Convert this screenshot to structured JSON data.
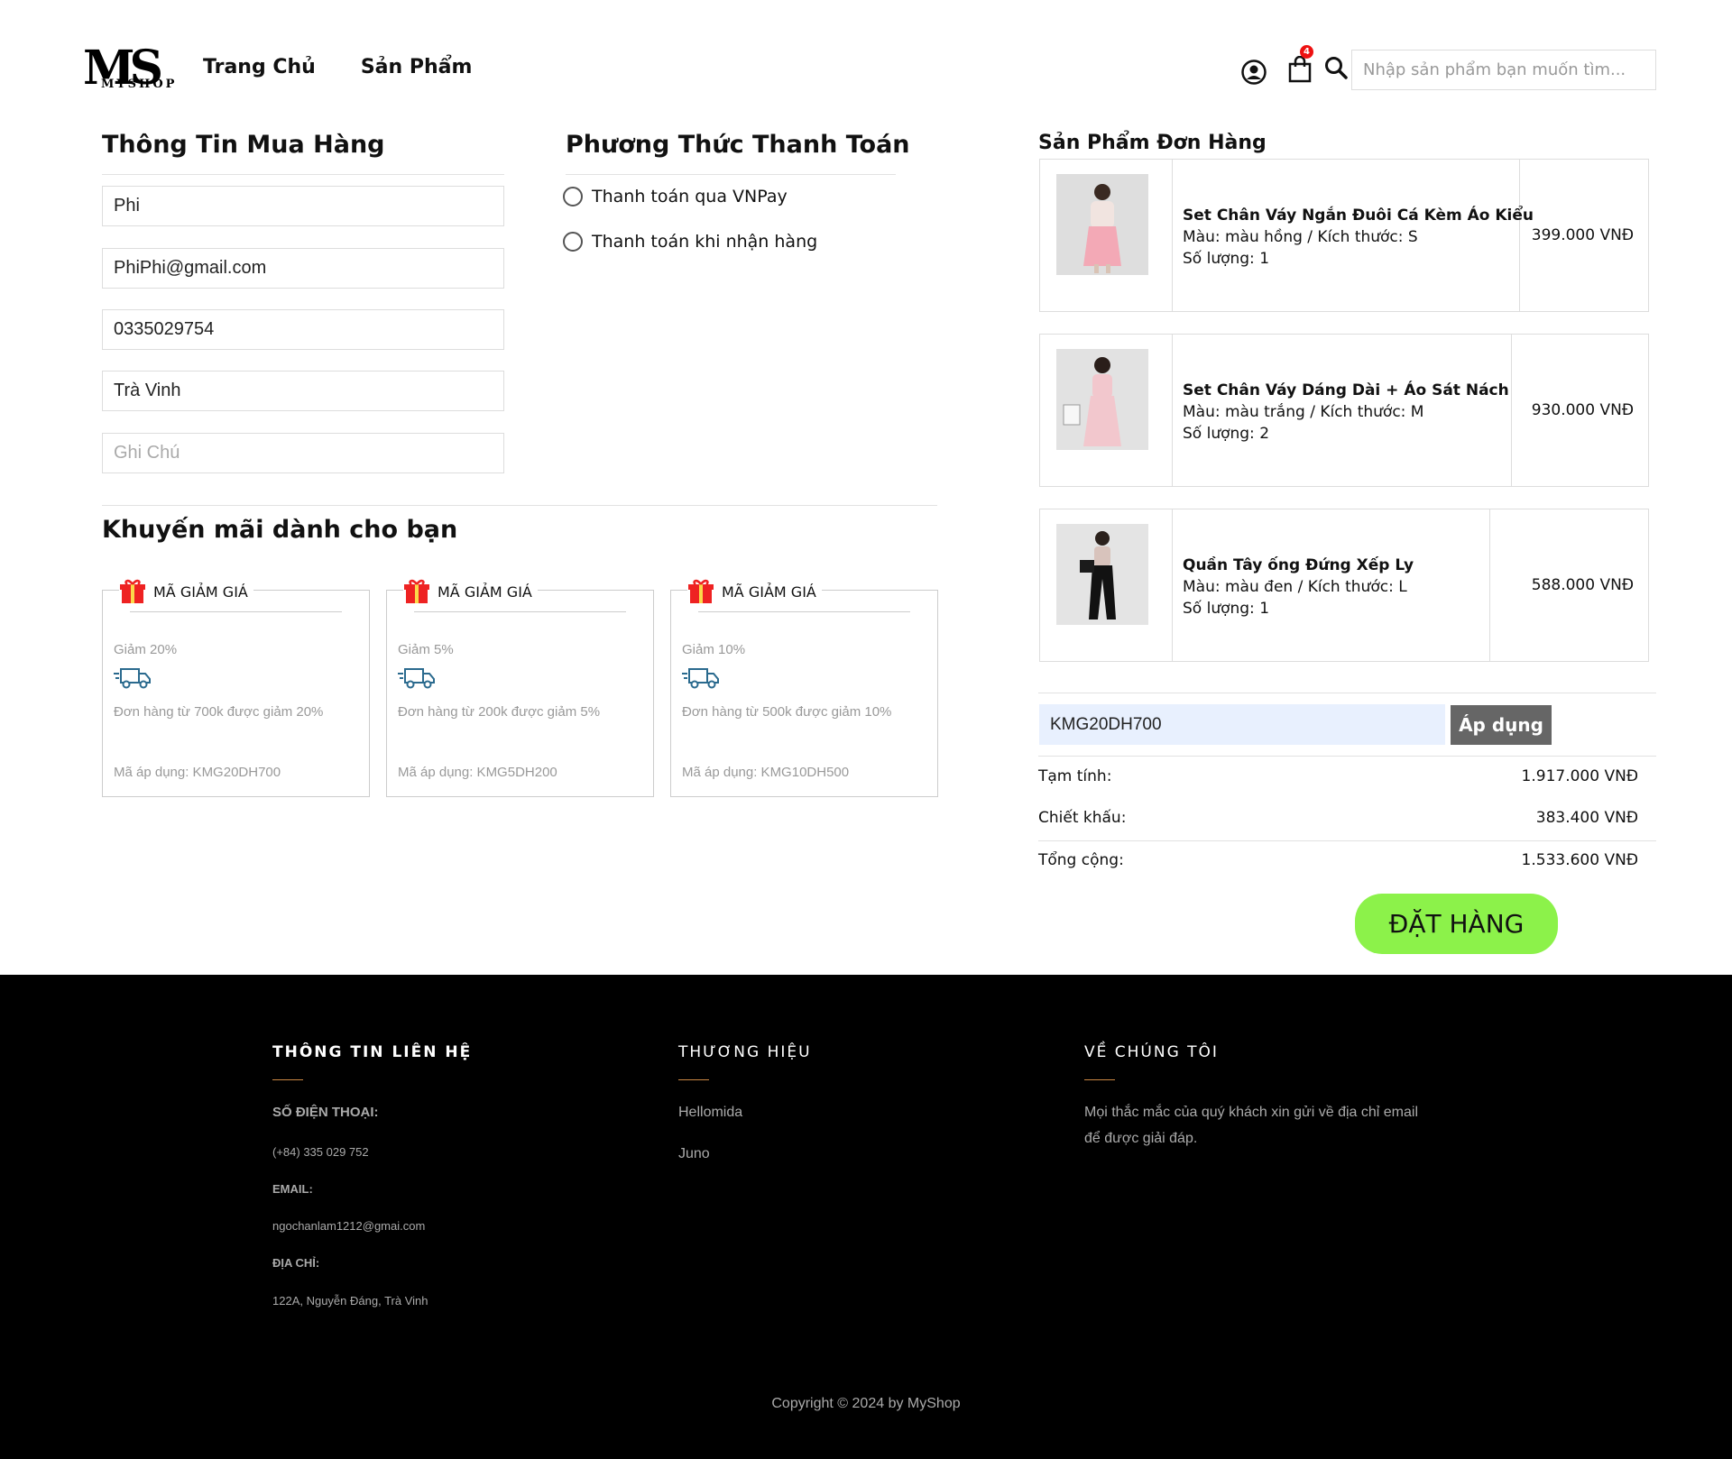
{
  "header": {
    "logo_main": "MS",
    "logo_sub": "MYSHOP",
    "nav": [
      "Trang Chủ",
      "Sản Phẩm"
    ],
    "cart_count": "4",
    "search_placeholder": "Nhập sản phẩm bạn muốn tìm..."
  },
  "buyer": {
    "title": "Thông Tin Mua Hàng",
    "name": "Phi",
    "email": "PhiPhi@gmail.com",
    "phone": "0335029754",
    "address": "Trà Vinh",
    "note_placeholder": "Ghi Chú"
  },
  "payment": {
    "title": "Phương Thức Thanh Toán",
    "options": [
      "Thanh toán qua VNPay",
      "Thanh toán khi nhận hàng"
    ]
  },
  "promo": {
    "title": "Khuyến mãi dành cho bạn",
    "vouchers": [
      {
        "label": "MÃ GIẢM GIÁ",
        "discount": "Giảm 20%",
        "desc": "Đơn hàng từ 700k được giảm 20%",
        "code": "Mã áp dụng: KMG20DH700"
      },
      {
        "label": "MÃ GIẢM GIÁ",
        "discount": "Giảm 5%",
        "desc": "Đơn hàng từ 200k được giảm 5%",
        "code": "Mã áp dụng: KMG5DH200"
      },
      {
        "label": "MÃ GIẢM GIÁ",
        "discount": "Giảm 10%",
        "desc": "Đơn hàng từ 500k được giảm 10%",
        "code": "Mã áp dụng: KMG10DH500"
      }
    ]
  },
  "order": {
    "title": "Sản Phẩm Đơn Hàng",
    "products": [
      {
        "name": "Set Chân Váy Ngắn Đuôi Cá Kèm Áo Kiểu",
        "variant": "Màu: màu hồng / Kích thước: S",
        "qty": "Số lượng: 1",
        "price": "399.000 VNĐ"
      },
      {
        "name": "Set Chân Váy Dáng Dài + Áo Sát Nách",
        "variant": "Màu: màu trắng / Kích thước: M",
        "qty": "Số lượng: 2",
        "price": "930.000 VNĐ"
      },
      {
        "name": "Quần Tây ống Đứng Xếp Ly",
        "variant": "Màu: màu đen / Kích thước: L",
        "qty": "Số lượng: 1",
        "price": "588.000 VNĐ"
      }
    ],
    "coupon_value": "KMG20DH700",
    "apply_label": "Áp dụng",
    "subtotal_label": "Tạm tính:",
    "subtotal": "1.917.000 VNĐ",
    "discount_label": "Chiết khấu:",
    "discount": "383.400 VNĐ",
    "total_label": "Tổng cộng:",
    "total": "1.533.600 VNĐ",
    "submit_label": "ĐẶT HÀNG"
  },
  "footer": {
    "contact_title": "THÔNG TIN LIÊN HỆ",
    "phone_label": "SỐ ĐIỆN THOẠI:",
    "phone": "(+84) 335 029 752",
    "email_label": "EMAIL:",
    "email": "ngochanlam1212@gmai.com",
    "addr_label": "ĐỊA CHỈ:",
    "addr": "122A, Nguyễn Đáng, Trà Vinh",
    "brand_title": "THƯƠNG HIỆU",
    "brands": [
      "Hellomida",
      "Juno"
    ],
    "about_title": "VỀ CHÚNG TÔI",
    "about_line1": "Mọi thắc mắc của quý khách xin gửi về địa chỉ email",
    "about_line2": "để được giải đáp.",
    "copyright": "Copyright © 2024 by MyShop"
  },
  "colors": {
    "order_button": "#8cf24a",
    "apply_button": "#666666",
    "footer_bg": "#000000",
    "badge": "#ee1111"
  }
}
